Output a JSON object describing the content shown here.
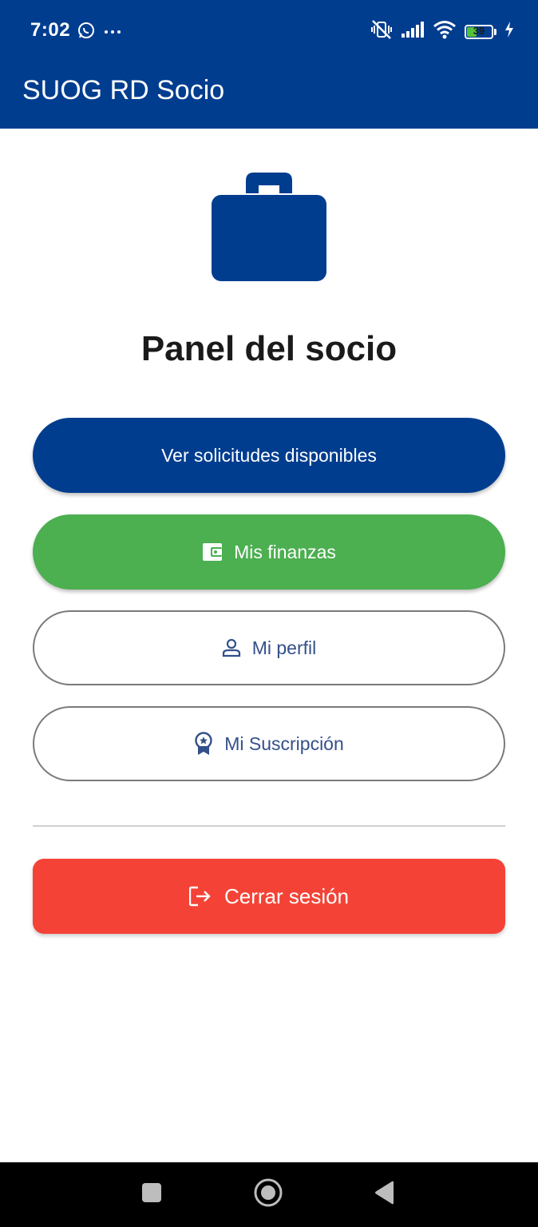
{
  "status_bar": {
    "time": "7:02",
    "battery_level": "39",
    "icons": [
      "whatsapp-icon",
      "more-dots-icon",
      "vibrate-off-icon",
      "signal-icon",
      "wifi-icon",
      "battery-icon",
      "charging-icon"
    ]
  },
  "app_bar": {
    "title": "SUOG RD Socio"
  },
  "main": {
    "hero_icon": "briefcase-icon",
    "title": "Panel del socio",
    "buttons": [
      {
        "label": "Ver solicitudes disponibles",
        "icon": ""
      },
      {
        "label": "Mis finanzas",
        "icon": "wallet-icon"
      },
      {
        "label": "Mi perfil",
        "icon": "person-icon"
      },
      {
        "label": "Mi Suscripción",
        "icon": "badge-icon"
      }
    ],
    "logout": {
      "label": "Cerrar sesión",
      "icon": "logout-icon"
    }
  },
  "colors": {
    "primary": "#003d8f",
    "success": "#4caf50",
    "danger": "#f44336",
    "outline_text": "#33508a"
  },
  "nav_bar": {
    "buttons": [
      "recents-button",
      "home-button",
      "back-button"
    ]
  }
}
